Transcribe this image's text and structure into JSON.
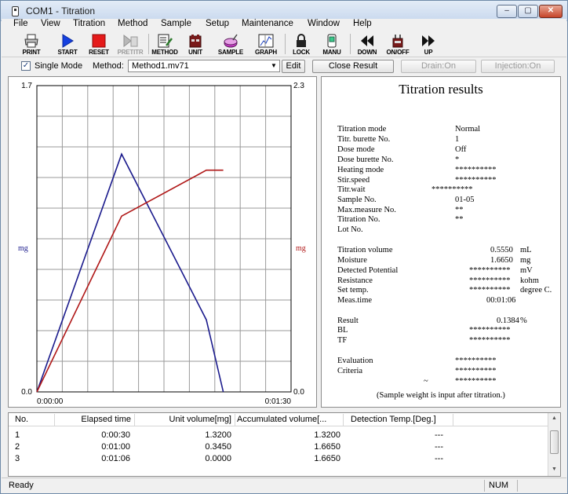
{
  "window": {
    "title": "COM1 - Titration",
    "min_label": "–",
    "max_label": "▢",
    "close_label": "✕"
  },
  "menu": [
    "File",
    "View",
    "Titration",
    "Method",
    "Sample",
    "Setup",
    "Maintenance",
    "Window",
    "Help"
  ],
  "toolbar": [
    {
      "label": "PRINT",
      "icon": "printer-icon",
      "enabled": true
    },
    {
      "label": "START",
      "icon": "start-icon",
      "enabled": true
    },
    {
      "label": "RESET",
      "icon": "reset-icon",
      "enabled": true
    },
    {
      "label": "PRETITR",
      "icon": "pretitration-icon",
      "enabled": false
    },
    {
      "label": "METHOD",
      "icon": "method-icon",
      "enabled": true
    },
    {
      "label": "UNIT",
      "icon": "unit-icon",
      "enabled": true
    },
    {
      "label": "SAMPLE",
      "icon": "sample-icon",
      "enabled": true
    },
    {
      "label": "GRAPH",
      "icon": "graph-icon",
      "enabled": true
    },
    {
      "label": "LOCK",
      "icon": "lock-icon",
      "enabled": true
    },
    {
      "label": "MANU",
      "icon": "manual-icon",
      "enabled": true
    },
    {
      "label": "DOWN",
      "icon": "down-icon",
      "enabled": true
    },
    {
      "label": "ON/OFF",
      "icon": "onoff-icon",
      "enabled": true
    },
    {
      "label": "UP",
      "icon": "up-icon",
      "enabled": true
    }
  ],
  "modebar": {
    "single_mode_label": "Single Mode",
    "single_mode_checked": true,
    "method_label": "Method:",
    "method_value": "Method1.mv71",
    "edit_button": "Edit",
    "close_result_button": "Close Result",
    "drain_button": "Drain:On",
    "injection_button": "Injection:On"
  },
  "chart_data": {
    "type": "line",
    "x_unit": "time",
    "xlim_seconds": [
      0,
      90
    ],
    "x_tick_labels": [
      "0:00:00",
      "0:01:30"
    ],
    "left_axis": {
      "label": "mg",
      "ylim": [
        0.0,
        1.7
      ],
      "tick_labels": [
        "1.7",
        "0.0"
      ]
    },
    "right_axis": {
      "label": "mg",
      "ylim": [
        0.0,
        2.3
      ],
      "tick_labels": [
        "2.3",
        "0.0"
      ]
    },
    "grid": true,
    "series": [
      {
        "axis": "left",
        "color": "#1a1a8c",
        "points": [
          [
            0,
            0.0
          ],
          [
            30,
            1.32
          ],
          [
            60,
            0.4
          ],
          [
            66,
            0.0
          ]
        ]
      },
      {
        "axis": "right",
        "color": "#b01818",
        "points": [
          [
            0,
            0.0
          ],
          [
            30,
            1.32
          ],
          [
            60,
            1.665
          ],
          [
            66,
            1.665
          ]
        ]
      }
    ]
  },
  "results": {
    "title": "Titration results",
    "rows": [
      {
        "label": "Titration mode",
        "value": "Normal",
        "unit": ""
      },
      {
        "label": "Titr. burette No.",
        "value": "1",
        "unit": ""
      },
      {
        "label": "Dose mode",
        "value": "Off",
        "unit": ""
      },
      {
        "label": "Dose burette No.",
        "value": "*",
        "unit": ""
      },
      {
        "label": "Heating mode",
        "value": "**********",
        "unit": ""
      },
      {
        "label": "Stir.speed",
        "value": "**********",
        "unit": ""
      },
      {
        "label": "Titr.wait",
        "value": "**********",
        "unit": ""
      },
      {
        "label": "Sample No.",
        "value": "01-05",
        "unit": ""
      },
      {
        "label": "Max.measure No.",
        "value": "**",
        "unit": ""
      },
      {
        "label": "Titration No.",
        "value": "**",
        "unit": ""
      },
      {
        "label": "Lot No.",
        "value": "",
        "unit": ""
      },
      {
        "label": "Titration volume",
        "value": "0.5550",
        "unit": "mL"
      },
      {
        "label": "Moisture",
        "value": "1.6650",
        "unit": "mg"
      },
      {
        "label": "Detected Potential",
        "value": "**********",
        "unit": "mV"
      },
      {
        "label": "Resistance",
        "value": "**********",
        "unit": "kohm"
      },
      {
        "label": "Set temp.",
        "value": "**********",
        "unit": "degree C."
      },
      {
        "label": "Meas.time",
        "value": "00:01:06",
        "unit": ""
      },
      {
        "label": "Result",
        "value": "0.1384",
        "unit": "%"
      },
      {
        "label": "BL",
        "value": "**********",
        "unit": ""
      },
      {
        "label": "TF",
        "value": "**********",
        "unit": ""
      },
      {
        "label": "Evaluation",
        "value": "**********",
        "unit": ""
      },
      {
        "label": "Criteria",
        "value": "**********",
        "unit": ""
      },
      {
        "label": "",
        "value": "~",
        "unit": "",
        "extra": "**********"
      }
    ],
    "note": "(Sample weight is input after titration.)"
  },
  "table": {
    "columns": [
      "No.",
      "Elapsed time",
      "Unit volume[mg]",
      "Accumulated volume[...",
      "Detection Temp.[Deg.]"
    ],
    "rows": [
      [
        "1",
        "0:00:30",
        "1.3200",
        "1.3200",
        "---"
      ],
      [
        "2",
        "0:01:00",
        "0.3450",
        "1.6650",
        "---"
      ],
      [
        "3",
        "0:01:06",
        "0.0000",
        "1.6650",
        "---"
      ]
    ]
  },
  "status": {
    "text": "Ready",
    "num": "NUM"
  }
}
